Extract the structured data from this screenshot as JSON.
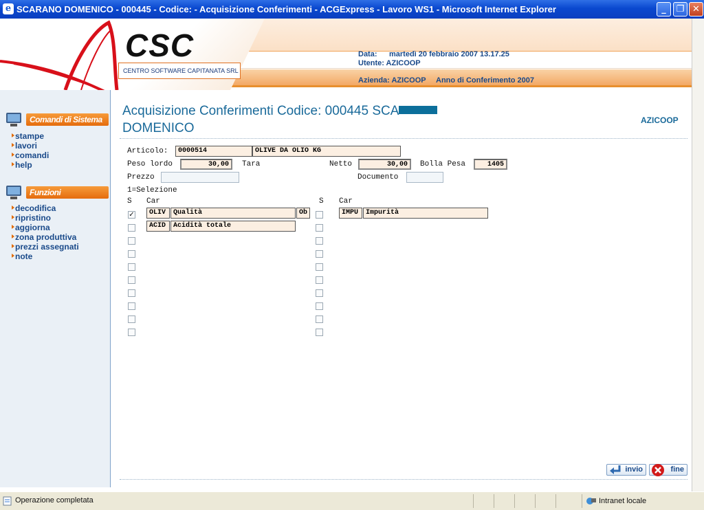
{
  "window": {
    "title": "SCARANO DOMENICO - 000445 - Codice: - Acquisizione Conferimenti - ACGExpress - Lavoro WS1 - Microsoft Internet Explorer"
  },
  "banner": {
    "logo_text": "CSC",
    "logo_subtitle": "CENTRO SOFTWARE CAPITANATA SRL",
    "data_label": "Data:",
    "data_value": "martedì 20 febbraio 2007 13.17.25",
    "utente": "Utente: AZICOOP",
    "azienda": "Azienda: AZICOOP",
    "anno": "Anno di Conferimento 2007"
  },
  "sidebar": {
    "section1": "Comandi di Sistema",
    "links1": [
      "stampe",
      "lavori",
      "comandi",
      "help"
    ],
    "section2": "Funzioni",
    "links2": [
      "decodifica",
      "ripristino",
      "aggiorna",
      "zona produttiva",
      "prezzi assegnati",
      "note"
    ]
  },
  "page": {
    "title_line1": "Acquisizione Conferimenti Codice: 000445 SCA",
    "title_line2": "DOMENICO",
    "company": "AZICOOP"
  },
  "form": {
    "articolo_label": "Articolo:",
    "articolo_code": "0000514",
    "articolo_desc": "OLIVE DA OLIO        KG",
    "peso_lordo_label": "Peso lordo",
    "peso_lordo": "30,00",
    "tara_label": "Tara",
    "netto_label": "Netto",
    "netto": "30,00",
    "bolla_label": "Bolla Pesa",
    "bolla": "1405",
    "prezzo_label": "Prezzo",
    "documento_label": "Documento",
    "selezione_hint": "1=Selezione",
    "col_s": "S",
    "col_car": "Car",
    "left_rows": [
      {
        "code": "OLIV",
        "desc": "Qualità",
        "extra": "Ob",
        "checked": true
      },
      {
        "code": "ACID",
        "desc": "Acidità totale",
        "extra": "",
        "checked": false
      }
    ],
    "right_rows": [
      {
        "code": "IMPU",
        "desc": "Impurità",
        "checked": false
      }
    ]
  },
  "buttons": {
    "invio": "invio",
    "fine": "fine"
  },
  "status": {
    "left": "Operazione completata",
    "zone": "Intranet locale"
  },
  "colors": {
    "title_bar": "#0a48cf",
    "accent_orange": "#e56c0d",
    "link_blue": "#1a4a8a",
    "title_text": "#1a6a9a"
  }
}
